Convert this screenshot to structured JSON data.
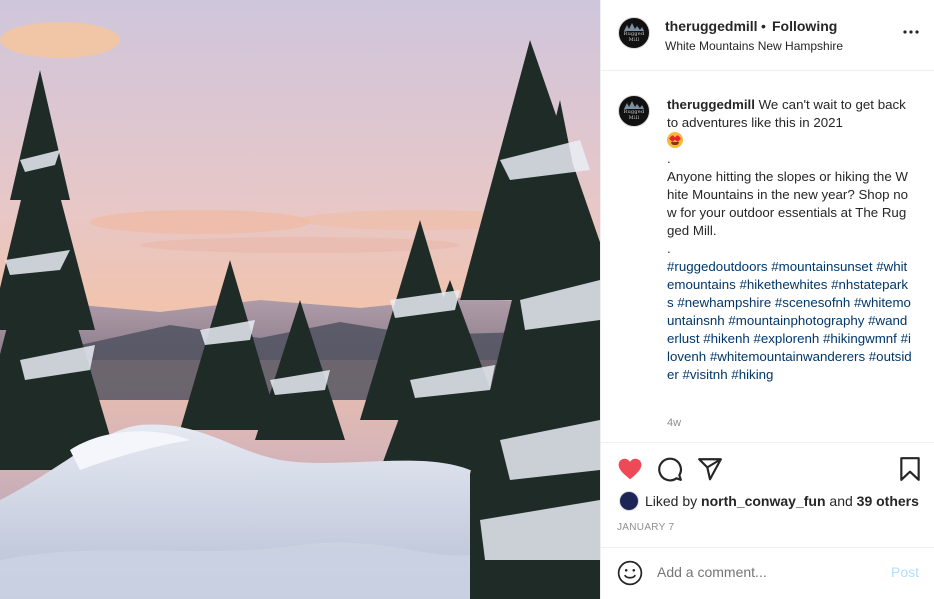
{
  "post": {
    "header": {
      "avatar_text": "Rugged Mill",
      "username": "theruggedmill",
      "separator": "•",
      "follow_status": "Following",
      "location": "White Mountains New Hampshire",
      "more_icon": "ellipsis-horizontal-icon"
    },
    "caption": {
      "username": "theruggedmill",
      "line1": "We can't wait to get back to adventures like this in 2021",
      "emoji": "heart-eyes-emoji",
      "dot1": ".",
      "line2": "Anyone hitting the slopes or hiking the White Mountains in the new year? Shop now for your outdoor essentials at The Rugged Mill.",
      "dot2": ".",
      "hashtags": "#ruggedoutdoors #mountainsunset #whitemountains #hikethewhites #nhstateparks #newhampshire #scenesofnh #whitemountainsnh #mountainphotography #wanderlust #hikenh #explorenh #hikingwmnf #ilovenh #whitemountainwanderers #outsider #visitnh #hiking",
      "time_ago": "4w"
    },
    "actions": {
      "icons": [
        "heart-filled-icon",
        "comment-icon",
        "share-icon",
        "bookmark-icon"
      ],
      "like_color": "#ed4956",
      "liked_by_prefix": "Liked by ",
      "liked_by_user": "north_conway_fun",
      "liked_by_and": " and ",
      "liked_by_others": "39 others",
      "date": "JANUARY 7"
    },
    "comment_box": {
      "placeholder": "Add a comment...",
      "post_label": "Post",
      "post_color": "#b2dffc"
    }
  }
}
